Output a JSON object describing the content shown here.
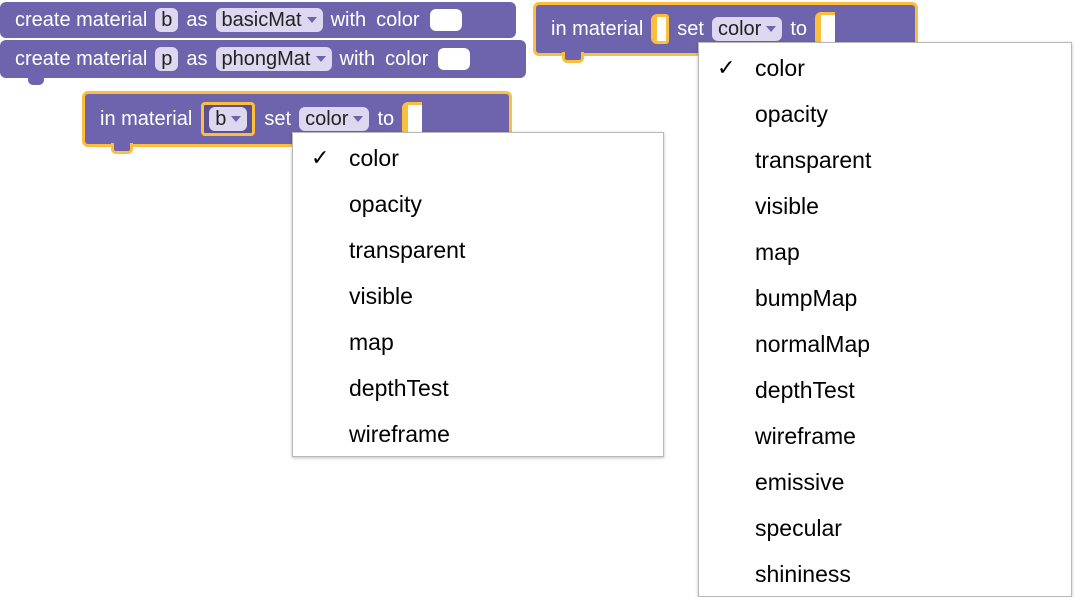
{
  "blocks": {
    "create1": {
      "create_label": "create material",
      "var": "b",
      "as_label": "as",
      "type": "basicMat",
      "with_label": "with",
      "color_label": "color"
    },
    "create2": {
      "create_label": "create material",
      "var": "p",
      "as_label": "as",
      "type": "phongMat",
      "with_label": "with",
      "color_label": "color"
    },
    "set_left": {
      "in_label": "in material",
      "var": "b",
      "set_label": "set",
      "property": "color",
      "to_label": "to"
    },
    "set_right": {
      "in_label": "in material",
      "set_label": "set",
      "property": "color",
      "to_label": "to"
    }
  },
  "menu_left": {
    "check": "✓",
    "items": [
      "color",
      "opacity",
      "transparent",
      "visible",
      "map",
      "depthTest",
      "wireframe"
    ],
    "selected": "color"
  },
  "menu_right": {
    "check": "✓",
    "items": [
      "color",
      "opacity",
      "transparent",
      "visible",
      "map",
      "bumpMap",
      "normalMap",
      "depthTest",
      "wireframe",
      "emissive",
      "specular",
      "shininess"
    ],
    "selected": "color"
  },
  "colors": {
    "block": "#6e64ad",
    "highlight": "#fcbf3d",
    "field": "#ddd8ef"
  }
}
